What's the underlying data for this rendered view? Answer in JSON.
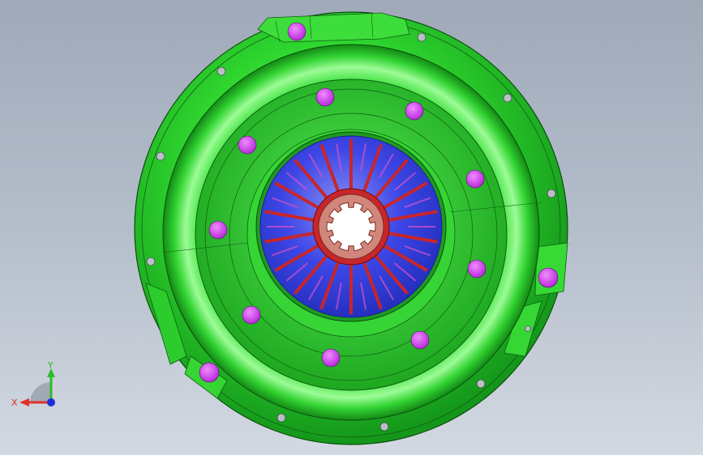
{
  "scene": {
    "model": "clutch-pressure-plate",
    "background_top": "#9fa9b8",
    "background_bottom": "#d3d9e2",
    "cover_color": "#2fd62f",
    "bolt_hole_color": "#cc33ee",
    "diaphragm_color": "#3c46e6",
    "finger_color": "#c8262a",
    "spline_color": "#d0867a"
  },
  "triad": {
    "x_label": "X",
    "y_label": "Y",
    "x_color": "#e0302a",
    "y_color": "#2bbd2b",
    "z_color": "#1d2fd8"
  }
}
